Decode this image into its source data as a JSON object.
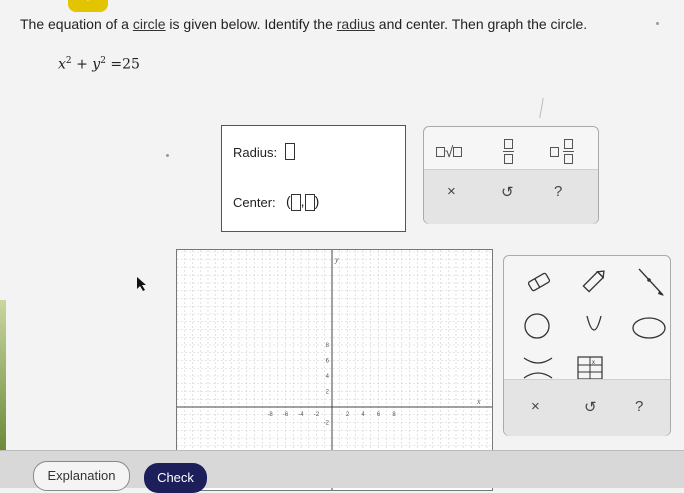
{
  "problem": {
    "part1": "The equation of a ",
    "link_circle": "circle",
    "part2": " is given below. Identify the ",
    "link_radius": "radius",
    "part3": " and center. Then graph the circle."
  },
  "equation": {
    "x": "x",
    "exp1": "2",
    "plus": "+",
    "y": "y",
    "exp2": "2",
    "eq": "=",
    "rhs": "25"
  },
  "answer": {
    "radius_label": "Radius:",
    "center_label": "Center:",
    "open_paren": "(",
    "comma": ",",
    "close_paren": ")"
  },
  "palette": {
    "sqrt_symbol": "√",
    "clear": "×",
    "undo": "↺",
    "help": "?"
  },
  "graph": {
    "x_axis_label": "x",
    "y_axis_label": "y",
    "x_ticks": [
      "-8",
      "-6",
      "-4",
      "-2",
      "2",
      "4",
      "6",
      "8"
    ],
    "y_ticks": [
      "8",
      "6",
      "4",
      "2",
      "-2"
    ]
  },
  "tools": {
    "clear": "×",
    "undo": "↺",
    "help": "?"
  },
  "footer": {
    "explanation": "Explanation",
    "check": "Check"
  }
}
